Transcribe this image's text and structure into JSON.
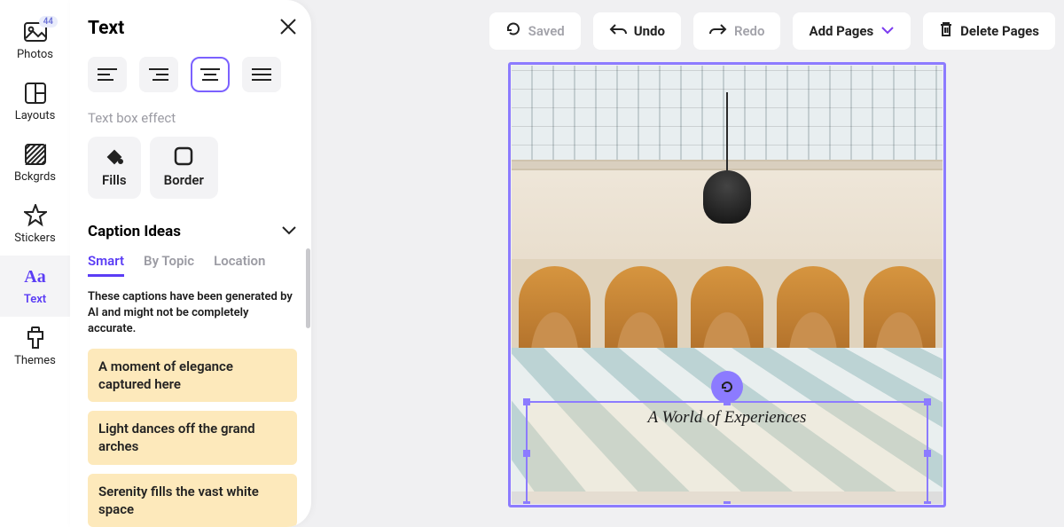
{
  "sidebar": {
    "items": [
      {
        "label": "Photos",
        "badge": "44"
      },
      {
        "label": "Layouts"
      },
      {
        "label": "Bckgrds"
      },
      {
        "label": "Stickers"
      },
      {
        "label": "Text"
      },
      {
        "label": "Themes"
      }
    ]
  },
  "panel": {
    "title": "Text",
    "effect_label": "Text box effect",
    "fills_label": "Fills",
    "border_label": "Border",
    "caption_header": "Caption Ideas",
    "tabs": {
      "smart": "Smart",
      "by_topic": "By Topic",
      "location": "Location"
    },
    "disclaimer": "These captions have been generated by AI and might not be completely accurate.",
    "captions": [
      "A moment of elegance captured here",
      "Light dances off the grand arches",
      "Serenity fills the vast white space"
    ]
  },
  "topbar": {
    "saved": "Saved",
    "undo": "Undo",
    "redo": "Redo",
    "add_pages": "Add Pages",
    "delete_pages": "Delete Pages"
  },
  "canvas": {
    "text_content": "A World of Experiences"
  }
}
